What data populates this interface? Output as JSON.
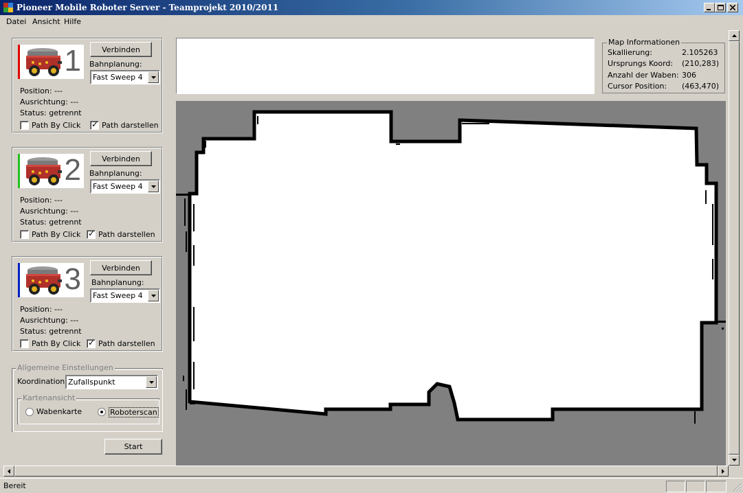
{
  "window": {
    "title": "Pioneer Mobile Roboter Server - Teamprojekt 2010/2011"
  },
  "menu": {
    "items": [
      "Datei",
      "Ansicht",
      "Hilfe"
    ]
  },
  "robots": [
    {
      "number": "1",
      "color": "#e00000",
      "connect_label": "Verbinden",
      "planning_label": "Bahnplanung:",
      "planning_value": "Fast Sweep 4",
      "position": "Position: ---",
      "orientation": "Ausrichtung: ---",
      "status": "Status: getrennt",
      "path_by_click_label": "Path By Click",
      "path_by_click_checked": false,
      "show_path_label": "Path darstellen",
      "show_path_checked": true
    },
    {
      "number": "2",
      "color": "#20c020",
      "connect_label": "Verbinden",
      "planning_label": "Bahnplanung:",
      "planning_value": "Fast Sweep 4",
      "position": "Position: ---",
      "orientation": "Ausrichtung: ---",
      "status": "Status: getrennt",
      "path_by_click_label": "Path By Click",
      "path_by_click_checked": false,
      "show_path_label": "Path darstellen",
      "show_path_checked": true
    },
    {
      "number": "3",
      "color": "#0020c0",
      "connect_label": "Verbinden",
      "planning_label": "Bahnplanung:",
      "planning_value": "Fast Sweep 4",
      "position": "Position: ---",
      "orientation": "Ausrichtung: ---",
      "status": "Status: getrennt",
      "path_by_click_label": "Path By Click",
      "path_by_click_checked": false,
      "show_path_label": "Path darstellen",
      "show_path_checked": true
    }
  ],
  "settings": {
    "group_title": "Allgemeine Einstellungen",
    "coordination_label": "Koordination:",
    "coordination_value": "Zufallspunkt",
    "map_view_title": "Kartenansicht",
    "radio_honeycomb": "Wabenkarte",
    "radio_robotscan": "Roboterscan",
    "selected": "Roboterscan",
    "start_label": "Start"
  },
  "map_info": {
    "title": "Map Informationen",
    "rows": [
      {
        "label": "Skallierung:",
        "value": "2.105263"
      },
      {
        "label": "Ursprungs Koord:",
        "value": "(210,283)"
      },
      {
        "label": "Anzahl der Waben:",
        "value": "306"
      },
      {
        "label": "Cursor Position:",
        "value": "(463,470)"
      }
    ]
  },
  "status": {
    "text": "Bereit"
  }
}
